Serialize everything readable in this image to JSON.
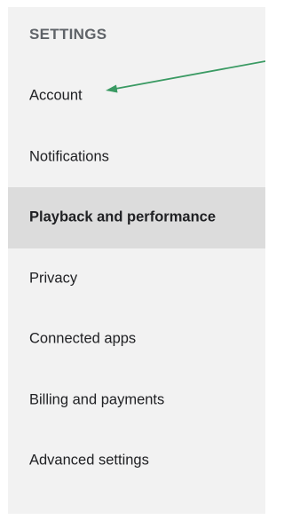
{
  "sidebar": {
    "heading": "SETTINGS",
    "active_index": 2,
    "items": [
      {
        "label": "Account"
      },
      {
        "label": "Notifications"
      },
      {
        "label": "Playback and performance"
      },
      {
        "label": "Privacy"
      },
      {
        "label": "Connected apps"
      },
      {
        "label": "Billing and payments"
      },
      {
        "label": "Advanced settings"
      }
    ]
  },
  "annotation": {
    "target": "Account",
    "color": "#3a9a63"
  },
  "colors": {
    "sidebar_background": "#f2f2f2",
    "active_item_background": "#dcdcdc",
    "heading_text": "#5f6368",
    "item_text": "#202124"
  }
}
